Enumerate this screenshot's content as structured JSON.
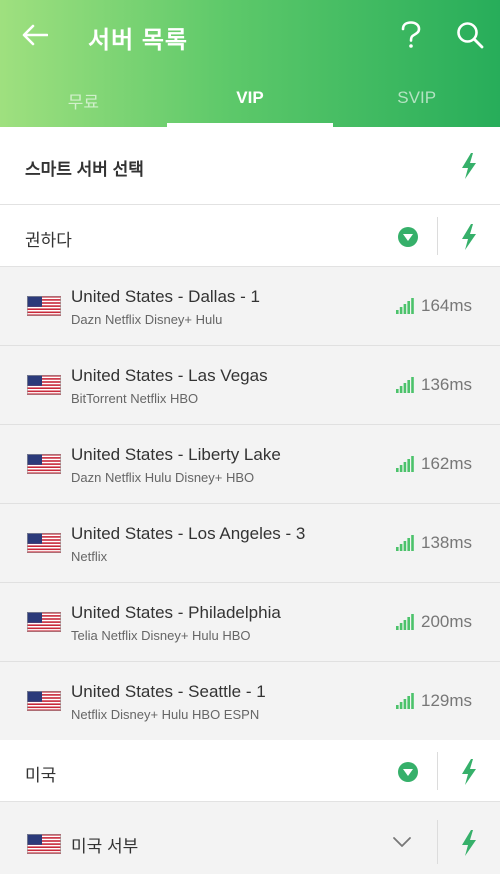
{
  "header": {
    "title": "서버 목록",
    "back_icon": "arrow-left-icon",
    "help_icon": "question-icon",
    "search_icon": "search-icon",
    "gradient": [
      "#9fe07f",
      "#27ad5a"
    ]
  },
  "tabs": [
    {
      "label": "무료",
      "active": false
    },
    {
      "label": "VIP",
      "active": true
    },
    {
      "label": "SVIP",
      "active": false
    }
  ],
  "smart": {
    "label": "스마트 서버 선택",
    "icon": "lightning-icon"
  },
  "recommended": {
    "label": "권하다",
    "icon": "chevron-down-circle-icon"
  },
  "servers": [
    {
      "name": "United States - Dallas - 1",
      "tags": "Dazn Netflix Disney+ Hulu",
      "latency": "164ms"
    },
    {
      "name": "United States - Las Vegas",
      "tags": "BitTorrent Netflix HBO",
      "latency": "136ms"
    },
    {
      "name": "United States - Liberty Lake",
      "tags": "Dazn Netflix Hulu Disney+ HBO",
      "latency": "162ms"
    },
    {
      "name": "United States - Los Angeles - 3",
      "tags": "Netflix",
      "latency": "138ms"
    },
    {
      "name": "United States - Philadelphia",
      "tags": "Telia Netflix Disney+ Hulu HBO",
      "latency": "200ms"
    },
    {
      "name": "United States - Seattle - 1",
      "tags": "Netflix Disney+ Hulu HBO ESPN",
      "latency": "129ms"
    }
  ],
  "country_group": {
    "label": "미국"
  },
  "region": {
    "label": "미국 서부"
  },
  "colors": {
    "accent": "#36b06a",
    "signal": "#4cc26b"
  }
}
